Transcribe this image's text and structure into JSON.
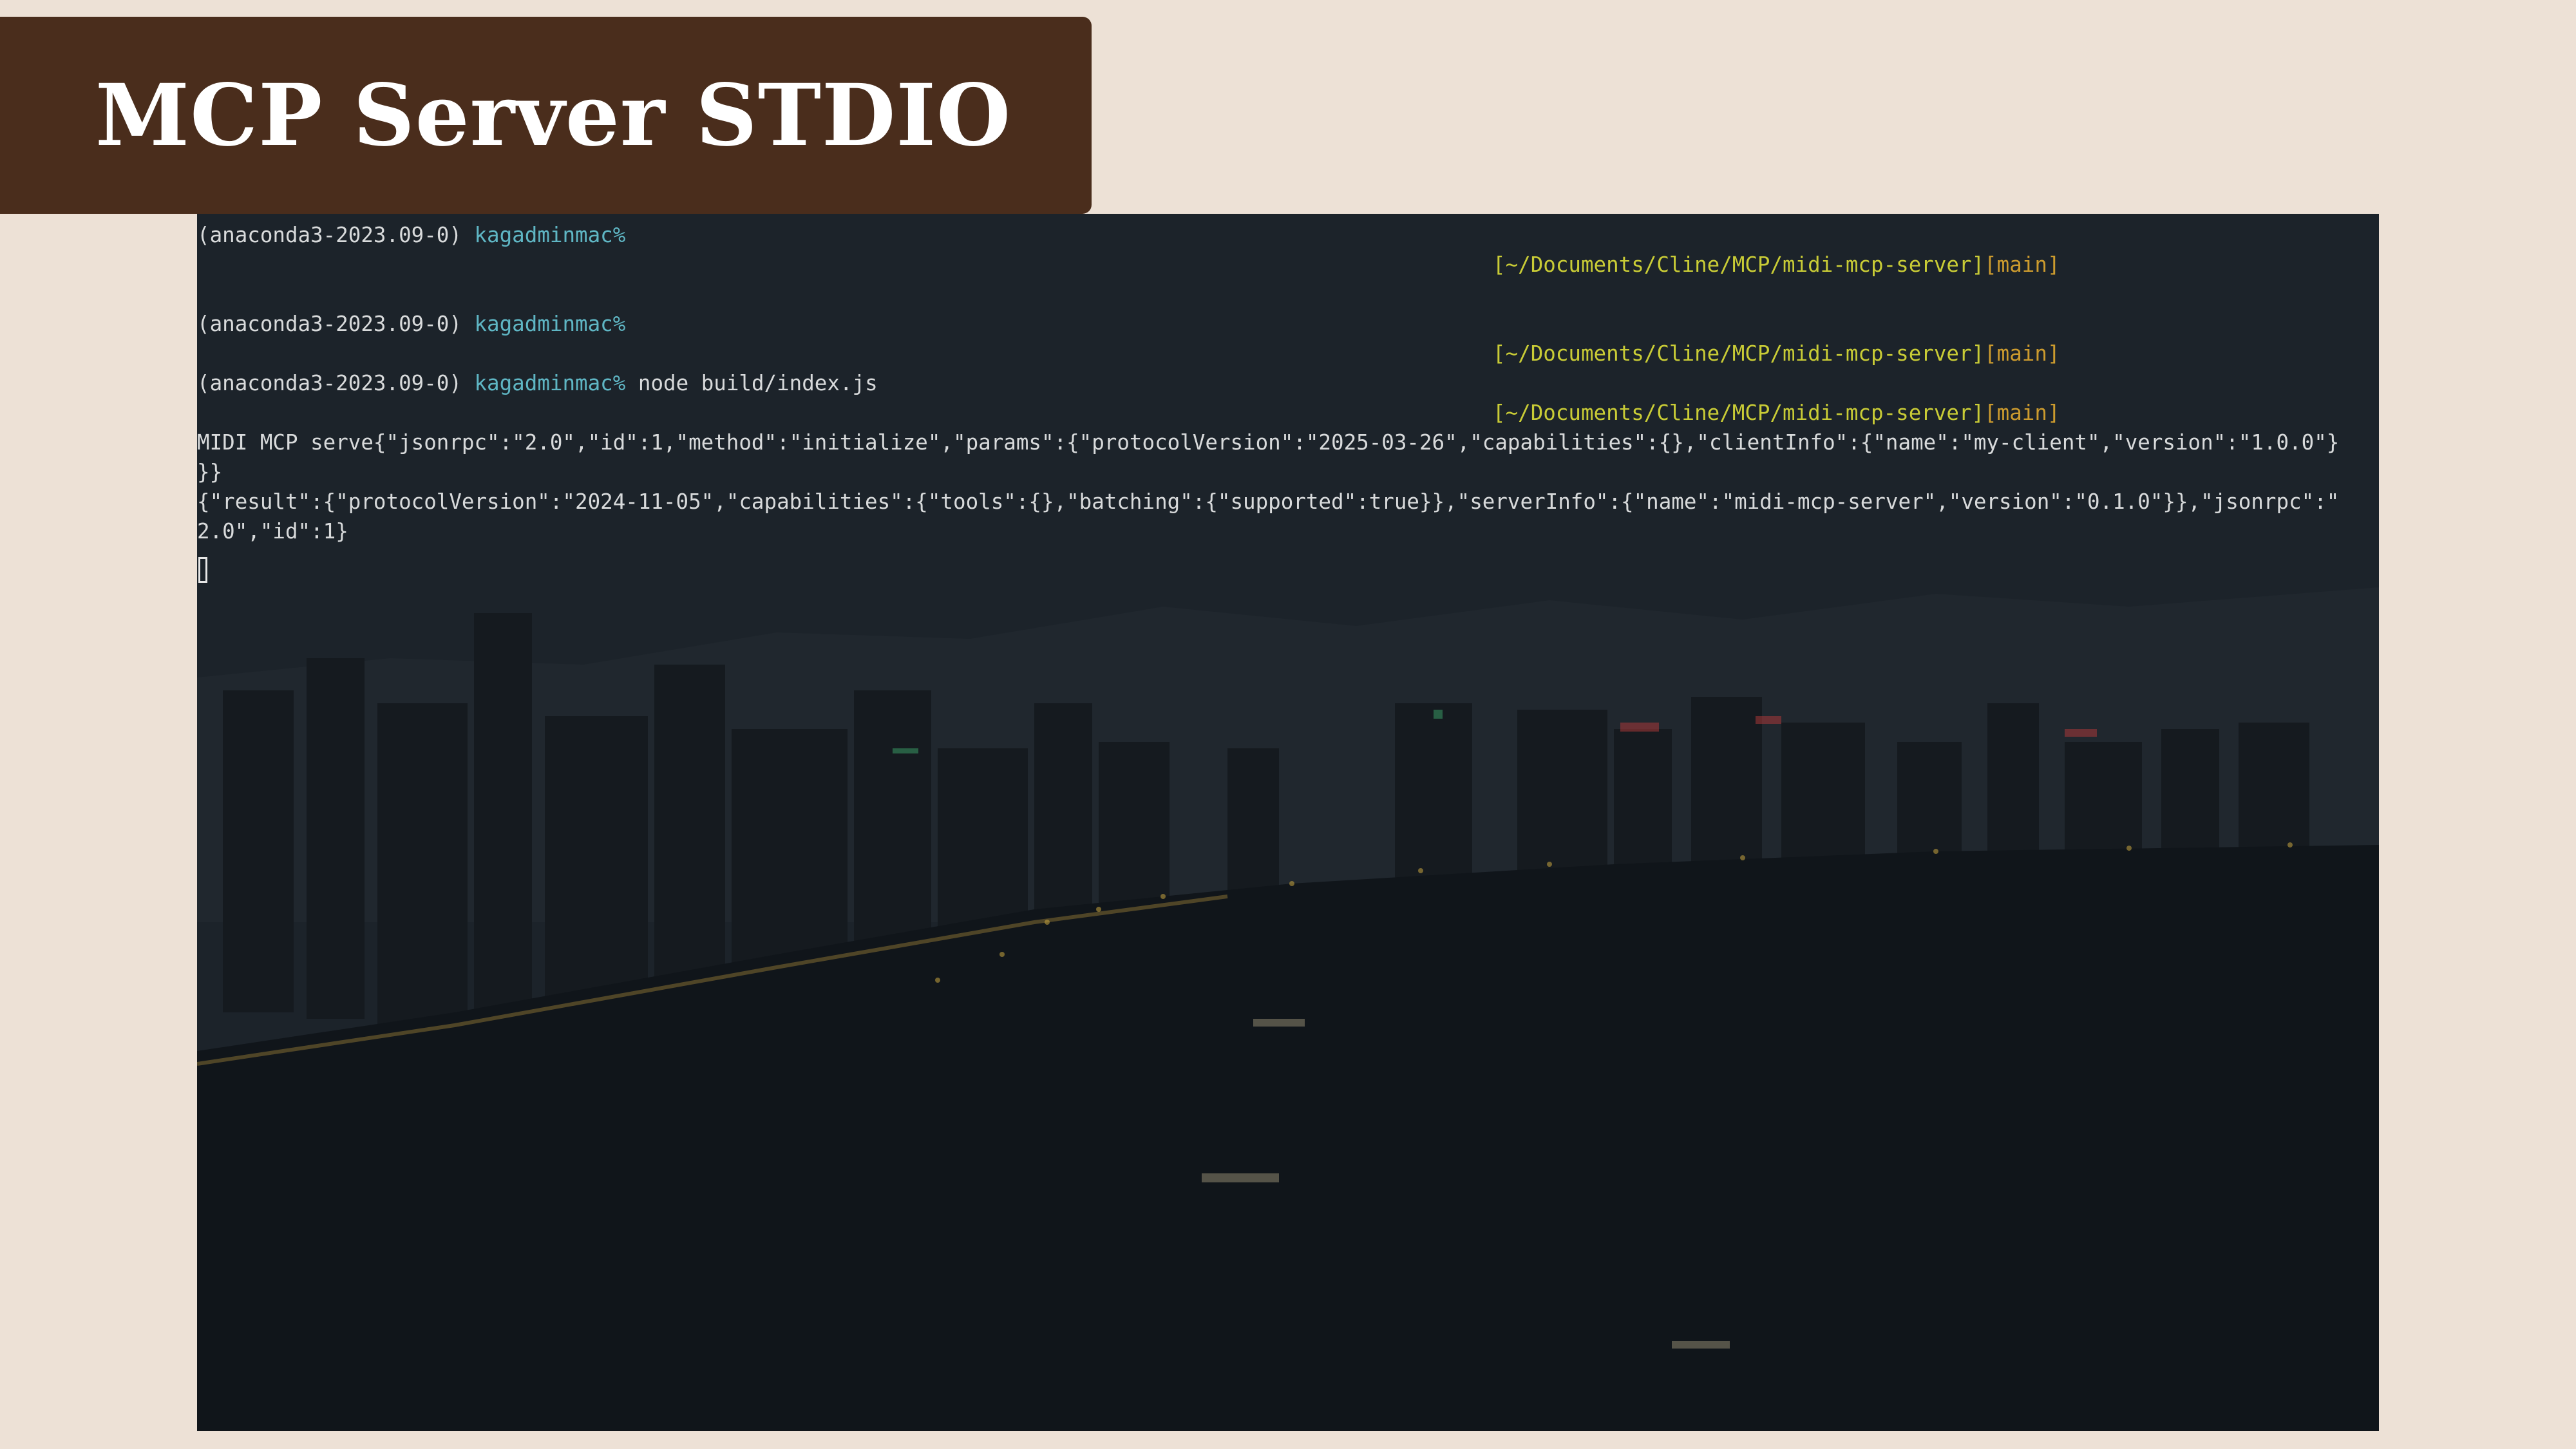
{
  "title": "MCP Server STDIO",
  "terminal": {
    "prompt_env": "(anaconda3-2023.09-0)",
    "prompt_user": "kagadminmac%",
    "path": "[~/Documents/Cline/MCP/midi-mcp-server]",
    "branch": "[main]",
    "command": "node build/index.js",
    "output": [
      "MIDI MCP serve{\"jsonrpc\":\"2.0\",\"id\":1,\"method\":\"initialize\",\"params\":{\"protocolVersion\":\"2025-03-26\",\"capabilities\":{},\"clientInfo\":{\"name\":\"my-client\",\"version\":\"1.0.0\"}",
      "}}",
      "{\"result\":{\"protocolVersion\":\"2024-11-05\",\"capabilities\":{\"tools\":{},\"batching\":{\"supported\":true}},\"serverInfo\":{\"name\":\"midi-mcp-server\",\"version\":\"0.1.0\"}},\"jsonrpc\":\"",
      "2.0\",\"id\":1}"
    ]
  },
  "colors": {
    "page_background": "#ede1d6",
    "title_background": "#4a2d1c",
    "title_text": "#ffffff",
    "terminal_text": "#d8dadb",
    "prompt_user": "#5fb6c4",
    "path": "#c9cc36",
    "branch": "#cc9b2e"
  },
  "icons": [
    "terminal-cursor-icon"
  ]
}
